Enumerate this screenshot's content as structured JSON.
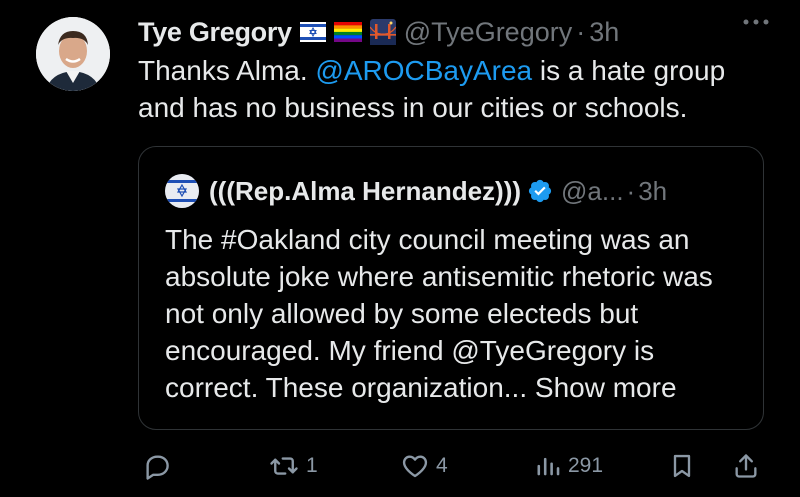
{
  "author": {
    "display_name": "Tye Gregory",
    "handle": "@TyeGregory",
    "separator": "·",
    "time": "3h",
    "badges": [
      "israel-flag-icon",
      "rainbow-flag-icon",
      "golden-gate-bridge-icon"
    ]
  },
  "tweet": {
    "text_before": "Thanks Alma. ",
    "mention": "@AROCBayArea",
    "text_after": " is a hate group and has no business in our cities or schools."
  },
  "quoted": {
    "display_name": "(((Rep.Alma Hernandez)))",
    "handle": "@a...",
    "separator": "·",
    "time": "3h",
    "text": "The #Oakland city council meeting was an absolute joke where antisemitic rhetoric was not only allowed by some electeds but encouraged. My friend  @TyeGregory is correct. These organization... ",
    "show_more": "Show more"
  },
  "actions": {
    "replies": "",
    "retweets": "1",
    "likes": "4",
    "views": "291"
  },
  "colors": {
    "background": "#000000",
    "text": "#e7e9ea",
    "muted": "#71767b",
    "accent": "#1d9bf0"
  }
}
